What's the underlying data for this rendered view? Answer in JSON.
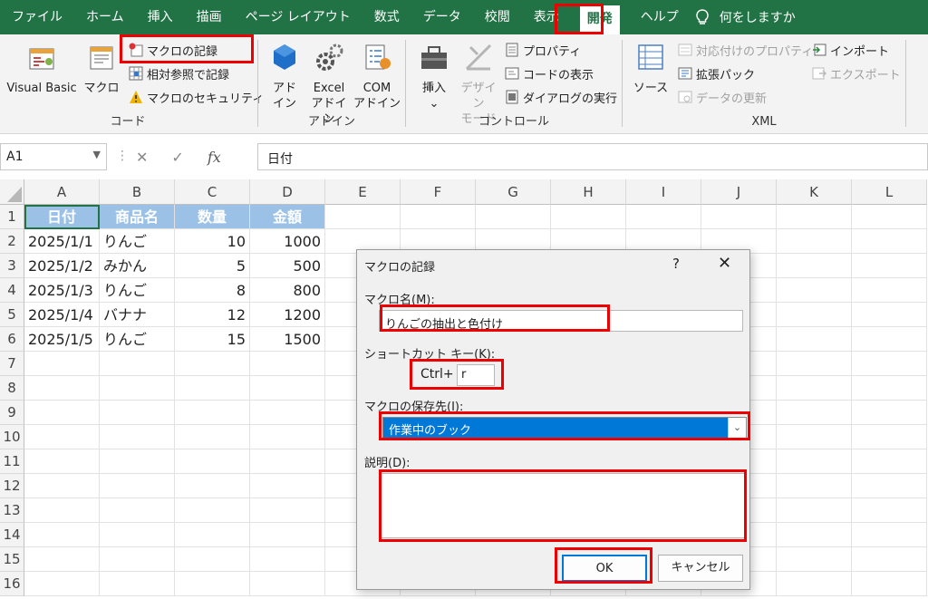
{
  "tabs": [
    "ファイル",
    "ホーム",
    "挿入",
    "描画",
    "ページ レイアウト",
    "数式",
    "データ",
    "校閲",
    "表示",
    "開発",
    "ヘルプ"
  ],
  "tell_me": "何をしますか",
  "ribbon": {
    "code": {
      "visual_basic": "Visual Basic",
      "macro": "マクロ",
      "record_macro": "マクロの記録",
      "relative_ref": "相対参照で記録",
      "macro_security": "マクロのセキュリティ",
      "label": "コード"
    },
    "addins": {
      "addin_1": "アド",
      "addin_2": "イン",
      "excel_1": "Excel",
      "excel_2": "アドイン",
      "com_1": "COM",
      "com_2": "アドイン",
      "label": "アドイン"
    },
    "controls": {
      "insert": "挿入",
      "insert_arrow": "⌄",
      "design_1": "デザイン",
      "design_2": "モード",
      "properties": "プロパティ",
      "view_code": "コードの表示",
      "run_dialog": "ダイアログの実行",
      "label": "コントロール"
    },
    "xml": {
      "source": "ソース",
      "map_props": "対応付けのプロパティ",
      "expansion": "拡張パック",
      "refresh": "データの更新",
      "import": "インポート",
      "export": "エクスポート",
      "label": "XML"
    }
  },
  "formula_bar": {
    "name_box": "A1",
    "fx": "fx",
    "value": "日付"
  },
  "columns": [
    "A",
    "B",
    "C",
    "D",
    "E",
    "F",
    "G",
    "H",
    "I",
    "J",
    "K",
    "L"
  ],
  "rows": [
    "1",
    "2",
    "3",
    "4",
    "5",
    "6",
    "7",
    "8",
    "9",
    "10",
    "11",
    "12",
    "13",
    "14",
    "15",
    "16"
  ],
  "table": {
    "headers": [
      "日付",
      "商品名",
      "数量",
      "金額"
    ],
    "data": [
      [
        "2025/1/1",
        "りんご",
        "10",
        "1000"
      ],
      [
        "2025/1/2",
        "みかん",
        "5",
        "500"
      ],
      [
        "2025/1/3",
        "りんご",
        "8",
        "800"
      ],
      [
        "2025/1/4",
        "バナナ",
        "12",
        "1200"
      ],
      [
        "2025/1/5",
        "りんご",
        "15",
        "1500"
      ]
    ]
  },
  "dialog": {
    "title": "マクロの記録",
    "help": "?",
    "close": "✕",
    "macro_name_label": "マクロ名(M):",
    "macro_name": "りんごの抽出と色付け",
    "shortcut_label": "ショートカット キー(K):",
    "ctrl_prefix": "Ctrl+",
    "shortcut_key": "r",
    "store_label": "マクロの保存先(I):",
    "store_value": "作業中のブック",
    "description_label": "説明(D):",
    "description": "",
    "ok": "OK",
    "cancel": "キャンセル"
  },
  "colors": {
    "excel_green": "#217346",
    "highlight_red": "#e00000",
    "header_blue": "#9bc2e6",
    "select_blue": "#0078d7"
  }
}
